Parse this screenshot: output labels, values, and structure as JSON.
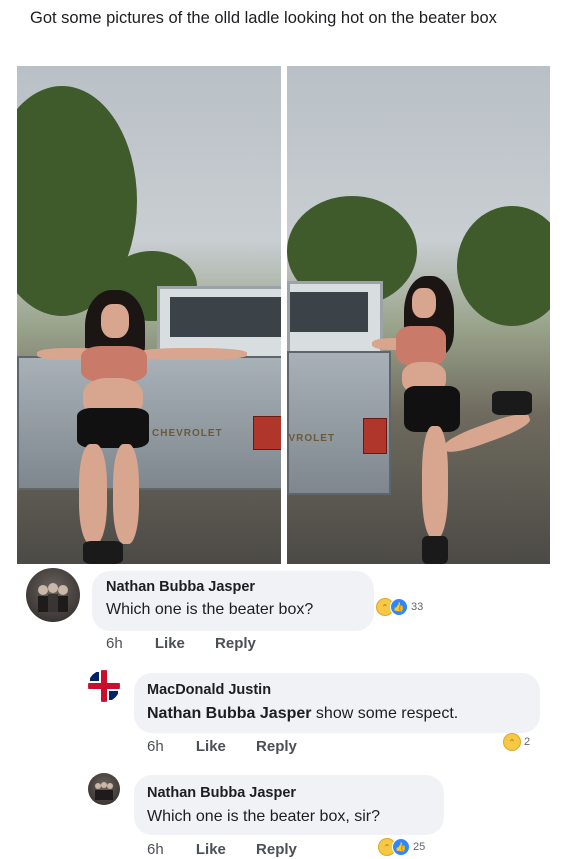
{
  "post": {
    "text": "Got some pictures of the olld ladle looking hot on the beater box"
  },
  "photos": {
    "left_tailgate": "CHEVROLET",
    "right_tailgate": "VROLET"
  },
  "comments": [
    {
      "author": "Nathan Bubba Jasper",
      "text": "Which one is the beater box?",
      "time": "6h",
      "like": "Like",
      "reply": "Reply",
      "reaction_count": "33"
    },
    {
      "author": "MacDonald Justin",
      "mention": "Nathan Bubba Jasper",
      "text": " show some respect.",
      "time": "6h",
      "like": "Like",
      "reply": "Reply",
      "reaction_count": "2"
    },
    {
      "author": "Nathan Bubba Jasper",
      "text": "Which one is the beater box, sir?",
      "time": "6h",
      "like": "Like",
      "reply": "Reply",
      "reaction_count": "25"
    }
  ],
  "icons": {
    "haha": "haha-reaction-icon",
    "like": "like-reaction-icon"
  },
  "colors": {
    "bubble": "#f0f2f5",
    "like_blue": "#2d88ff",
    "haha_yellow": "#f7c844"
  }
}
